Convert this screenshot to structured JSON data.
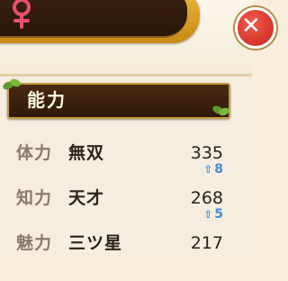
{
  "header": {
    "gender_icon": "female-symbol-icon"
  },
  "close_icon": "close-icon",
  "section": {
    "title": "能力"
  },
  "stats": [
    {
      "name": "体力",
      "rank": "無双",
      "value": "335",
      "bonus": "8"
    },
    {
      "name": "知力",
      "rank": "天才",
      "value": "268",
      "bonus": "5"
    },
    {
      "name": "魅力",
      "rank": "三ツ星",
      "value": "217",
      "bonus": ""
    }
  ],
  "colors": {
    "panel_bg": "#f5ede0",
    "header_dark": "#2f1809",
    "gold_trim": "#c99a3a",
    "gender_pink": "#e8506a",
    "close_red": "#d9342a",
    "bonus_blue": "#3d8fd6"
  }
}
